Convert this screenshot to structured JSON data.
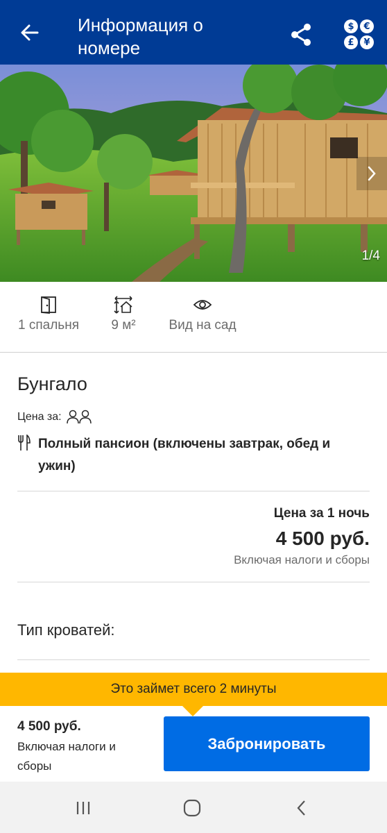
{
  "header": {
    "title": "Информация о номере",
    "back_icon": "arrow-left-icon",
    "share_icon": "share-icon",
    "currency_icon": "currency-icon",
    "currency_symbols": [
      "$",
      "€",
      "£",
      "¥"
    ],
    "bg_color": "#003b95"
  },
  "gallery": {
    "counter": "1/4",
    "next_icon": "chevron-right-icon"
  },
  "facilities": [
    {
      "icon": "door-icon",
      "label": "1 спальня"
    },
    {
      "icon": "room-size-icon",
      "label": "9 м²"
    },
    {
      "icon": "eye-icon",
      "label": "Вид на сад"
    }
  ],
  "room": {
    "name": "Бунгало",
    "price_for_label": "Цена за:",
    "persons_icon": "two-persons-icon",
    "meal_icon": "cutlery-icon",
    "meal_plan": "Полный пансион (включены завтрак, обед и ужин)"
  },
  "pricing": {
    "label": "Цена за 1 ночь",
    "price": "4 500 руб.",
    "taxes_note": "Включая налоги и сборы"
  },
  "beds": {
    "label": "Тип кроватей:"
  },
  "banner": {
    "text": "Это займет всего 2 минуты",
    "color": "#ffb700"
  },
  "footer": {
    "price": "4 500 руб.",
    "taxes_note": "Включая налоги и сборы",
    "book_button": "Забронировать",
    "button_color": "#006ce4"
  },
  "system_nav": {
    "recents_icon": "recent-apps-icon",
    "home_icon": "home-icon",
    "back_icon": "back-chevron-icon"
  }
}
